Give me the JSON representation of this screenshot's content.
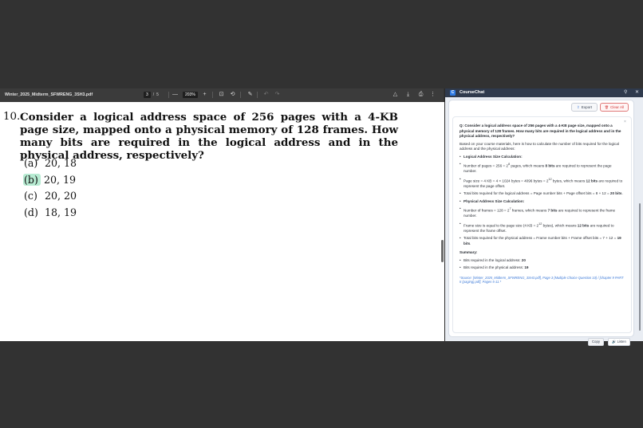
{
  "pdf_viewer": {
    "file_name": "Winter_2025_Midterm_SFWRENG_3SH3.pdf",
    "current_page": "3",
    "page_sep": "/",
    "total_pages": "5",
    "zoom_out": "—",
    "zoom": "203%",
    "zoom_in": "+",
    "toolbar_icons": {
      "fit": "⊡",
      "rotate": "⟲",
      "draw": "✎",
      "undo": "↶",
      "redo": "↷",
      "drive": "△",
      "download": "⤓",
      "print": "⎙",
      "more": "⋮"
    }
  },
  "question": {
    "number": "10.",
    "text": "Consider a logical address space of 256 pages with a 4-KB page size, mapped onto a physical memory of 128 frames. How many bits are required in the logical address and in the physical address, respectively?",
    "options": [
      {
        "letter": "(a)",
        "value": "20, 18"
      },
      {
        "letter": "(b)",
        "value": "20, 19"
      },
      {
        "letter": "(c)",
        "value": "20, 20"
      },
      {
        "letter": "(d)",
        "value": "18, 19"
      }
    ]
  },
  "chat": {
    "logo": "C",
    "title": "CourseChat",
    "header_icons": {
      "pin": "⚲",
      "close": "✕"
    },
    "export_icon": "⇪",
    "export_label": "Export",
    "clear_icon": "🗑",
    "clear_label": "Clear All",
    "message_close": "×",
    "question": "Q: Consider a logical address space of 256 pages with a 4-KB page size, mapped onto a physical memory of 128 frames. How many bits are required in the logical address and in the physical address, respectively?",
    "intro": "Based on your course materials, here is how to calculate the number of bits required for the logical address and the physical address:",
    "logical_heading": "Logical Address Size Calculation:",
    "logical_b1_a": "Number of pages = 256 = 2",
    "logical_b1_sup": "8",
    "logical_b1_b": " pages, which means ",
    "logical_b1_bold": "8 bits",
    "logical_b1_c": " are required to represent the page number.",
    "logical_b2_a": "Page size = 4 KB = 4 × 1024 bytes = 4096 bytes = 2",
    "logical_b2_sup": "12",
    "logical_b2_b": " bytes, which means ",
    "logical_b2_bold": "12 bits",
    "logical_b2_c": " are required to represent the page offset.",
    "logical_b3_a": "Total bits required for the logical address = Page number bits + Page offset bits = 8 + 12 = ",
    "logical_b3_bold": "20 bits",
    "logical_b3_c": ".",
    "physical_heading": "Physical Address Size Calculation:",
    "physical_b1_a": "Number of frames = 128 = 2",
    "physical_b1_sup": "7",
    "physical_b1_b": " frames, which means ",
    "physical_b1_bold": "7 bits",
    "physical_b1_c": " are required to represent the frame number.",
    "physical_b2_a": "Frame size is equal to the page size (4 KB = 2",
    "physical_b2_sup": "12",
    "physical_b2_b": " bytes), which means ",
    "physical_b2_bold": "12 bits",
    "physical_b2_c": " are required to represent the frame offset.",
    "physical_b3_a": "Total bits required for the physical address = Frame number bits + Frame offset bits = 7 + 12 = ",
    "physical_b3_bold": "19 bits",
    "physical_b3_c": ".",
    "summary_heading": "Summary:",
    "summary_b1_a": "Bits required in the logical address: ",
    "summary_b1_bold": "20",
    "summary_b2_a": "Bits required in the physical address: ",
    "summary_b2_bold": "19",
    "source": "*Source: [Winter_2025_Midterm_SFWRENG_3SH3.pdf], Page 3 (Multiple Choice Question 10) / [chapter 9 PART II (paging).pdf], Pages 5-11.*",
    "copy_label": "Copy",
    "listen_label": "🔊 Listen"
  }
}
